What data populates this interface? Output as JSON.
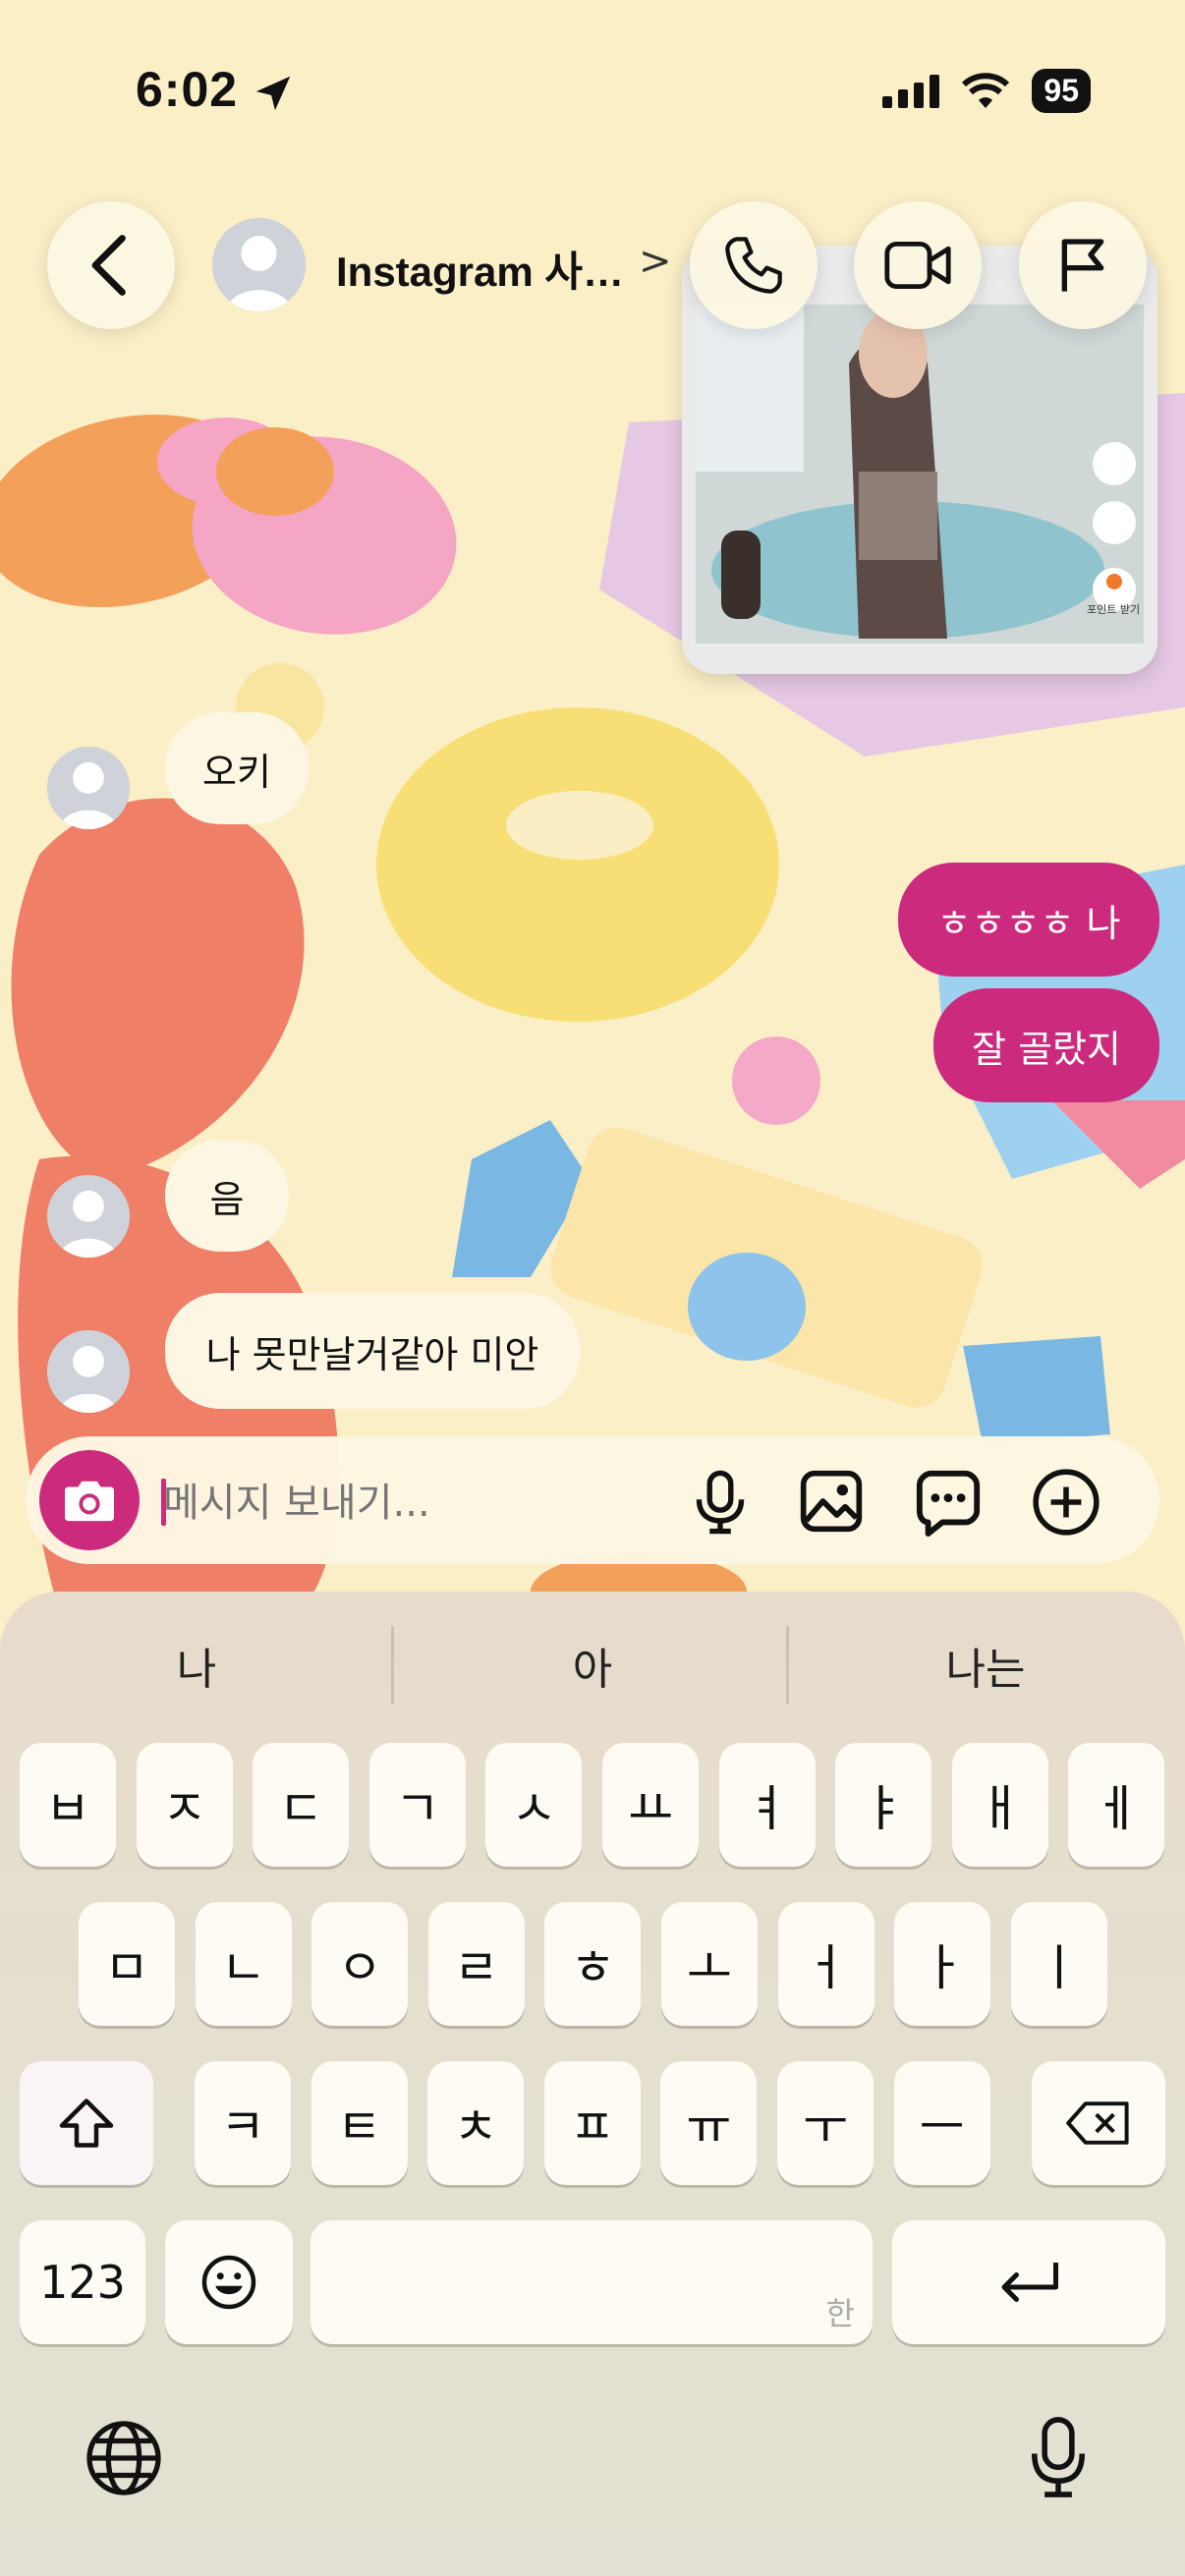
{
  "status_bar": {
    "time": "6:02",
    "battery": "95"
  },
  "header": {
    "title": "Instagram 사…",
    "title_chevron": ">"
  },
  "video": {
    "hint": "포인트 받기"
  },
  "messages": [
    {
      "side": "in",
      "text": "오키"
    },
    {
      "side": "out",
      "text": "ㅎㅎㅎㅎ 나"
    },
    {
      "side": "out",
      "text": "잘 골랐지"
    },
    {
      "side": "in",
      "text": "음"
    },
    {
      "side": "in",
      "text": "나 못만날거같아 미안"
    }
  ],
  "composer": {
    "placeholder": "메시지 보내기..."
  },
  "keyboard": {
    "suggestions": [
      "나",
      "아",
      "나는"
    ],
    "row1": [
      "ㅂ",
      "ㅈ",
      "ㄷ",
      "ㄱ",
      "ㅅ",
      "ㅛ",
      "ㅕ",
      "ㅑ",
      "ㅐ",
      "ㅔ"
    ],
    "row2": [
      "ㅁ",
      "ㄴ",
      "ㅇ",
      "ㄹ",
      "ㅎ",
      "ㅗ",
      "ㅓ",
      "ㅏ",
      "ㅣ"
    ],
    "row3": [
      "ㅋ",
      "ㅌ",
      "ㅊ",
      "ㅍ",
      "ㅠ",
      "ㅜ",
      "ㅡ"
    ],
    "numbers_key": "123",
    "space_hint": "한"
  },
  "colors": {
    "accent": "#cc2a7c",
    "background": "#fbefc7"
  }
}
